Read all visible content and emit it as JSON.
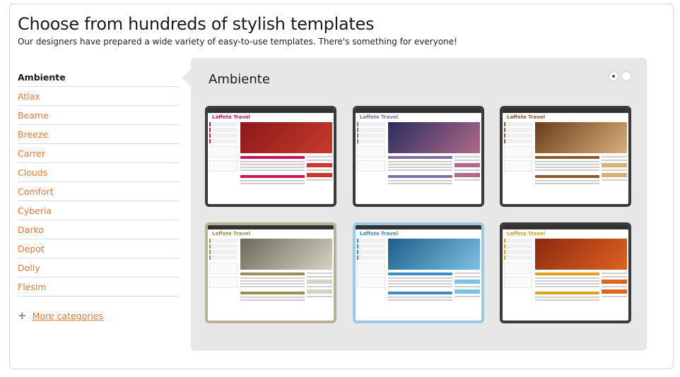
{
  "header": {
    "title": "Choose from hundreds of stylish templates",
    "subtitle": "Our designers have prepared a wide variety of easy-to-use templates. There's something for everyone!"
  },
  "sidebar": {
    "categories": [
      "Ambiente",
      "Atlax",
      "Beame",
      "Breeze",
      "Carrer",
      "Clouds",
      "Comfort",
      "Cyberia",
      "Darko",
      "Depot",
      "Dolly",
      "Flesim"
    ],
    "active": "Ambiente",
    "more_label": "More categories",
    "more_icon": "plus-icon"
  },
  "panel": {
    "title": "Ambiente",
    "pager": {
      "pages": 2,
      "current": 1
    }
  },
  "templates": [
    {
      "logo": "Laffete Travel",
      "accent": "#c2185b",
      "hero": "#8b1a1a",
      "hero2": "#c73a2b",
      "frame": "#3a3a3a"
    },
    {
      "logo": "Laffete Travel",
      "accent": "#7e6fa8",
      "hero": "#2b2c5e",
      "hero2": "#b06a8a",
      "frame": "#3a3a3a"
    },
    {
      "logo": "Laffete Travel",
      "accent": "#8b5a2b",
      "hero": "#6a3d1c",
      "hero2": "#d8b07a",
      "frame": "#3a3a3a"
    },
    {
      "logo": "Laffete Travel",
      "accent": "#9a8f55",
      "hero": "#6e6a5a",
      "hero2": "#d6d2c4",
      "frame": "#b7b19a"
    },
    {
      "logo": "Laffete Travel",
      "accent": "#3b8ec4",
      "hero": "#1d5e86",
      "hero2": "#7fc0e6",
      "frame": "#9cc9e8"
    },
    {
      "logo": "Laffete Travel",
      "accent": "#e0a020",
      "hero": "#8b2a10",
      "hero2": "#e0621f",
      "frame": "#3a3a3a"
    }
  ]
}
